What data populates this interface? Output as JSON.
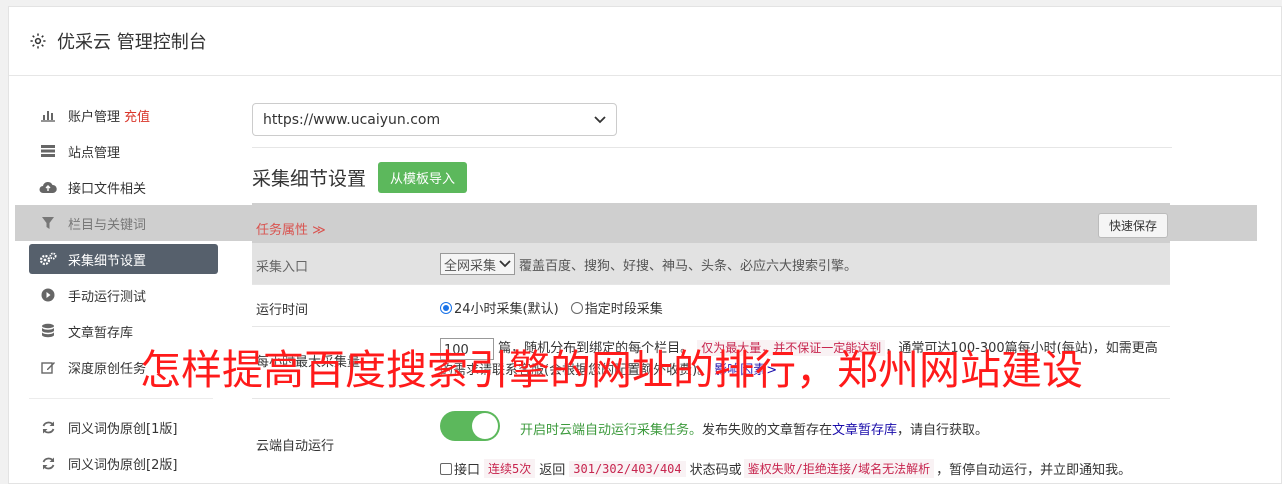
{
  "header": {
    "title": "优采云 管理控制台",
    "icon": "gear-icon"
  },
  "sidebar": {
    "items": [
      {
        "label": "账户管理",
        "badge": "充值",
        "icon": "bar-chart-icon"
      },
      {
        "label": "站点管理",
        "icon": "server-icon"
      },
      {
        "label": "接口文件相关",
        "icon": "cloud-upload-icon"
      },
      {
        "label": "栏目与关键词",
        "icon": "filter-icon"
      },
      {
        "label": "采集细节设置",
        "icon": "cogs-icon"
      },
      {
        "label": "手动运行测试",
        "icon": "play-circle-icon"
      },
      {
        "label": "文章暂存库",
        "icon": "database-icon"
      },
      {
        "label": "深度原创任务",
        "icon": "edit-icon"
      },
      {
        "label": "同义词伪原创[1版]",
        "icon": "refresh-icon"
      },
      {
        "label": "同义词伪原创[2版]",
        "icon": "refresh-icon"
      }
    ]
  },
  "main": {
    "site_select": "https://www.ucaiyun.com",
    "section_title": "采集细节设置",
    "import_button": "从模板导入",
    "task_attr": "任务属性 ≫",
    "quick_save": "快速保存",
    "entry": {
      "label": "采集入口",
      "select_value": "全网采集",
      "desc": "覆盖百度、搜狗、好搜、神马、头条、必应六大搜索引擎。"
    },
    "time": {
      "label": "运行时间",
      "option1": "24小时采集(默认)",
      "option2": "指定时段采集"
    },
    "max": {
      "label": "每小时最大采集量",
      "value": "100",
      "text1": "篇，随机分布到绑定的每个栏目。",
      "warn": "仅为最大量，并不保证一定能达到",
      "text2": "，通常可达100-300篇每小时(每站)，如需更高的需求请联系客服(会根据您的配置额外收费)。",
      "link": "影响因素>"
    },
    "cloud": {
      "label": "云端自动运行",
      "enabled_text": "开启时云端自动运行采集任务。",
      "desc1": "发布失败的文章暂存在",
      "link": "文章暂存库",
      "desc2": "，请自行获取。",
      "check_label": "接口",
      "code1": "连续5次",
      "text_a": "返回",
      "code2": "301/302/403/404",
      "text_b": "状态码或",
      "code3": "鉴权失败/拒绝连接/域名无法解析",
      "text_c": "，暂停自动运行，并立即通知我。"
    }
  },
  "overlay": "怎样提高百度搜索引擎的网址的排行，郑州网站建设"
}
